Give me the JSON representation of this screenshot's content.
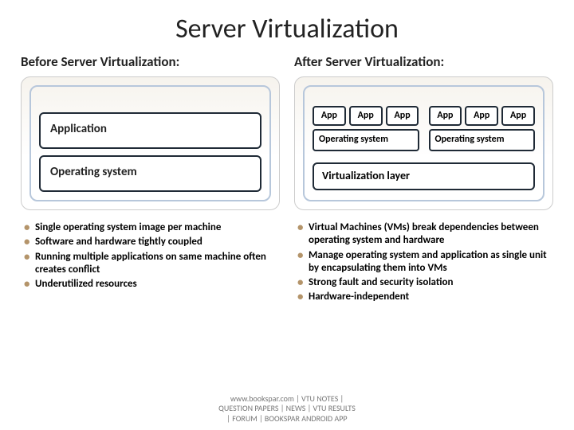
{
  "title": "Server Virtualization",
  "left": {
    "header": "Before Server Virtualization:",
    "application": "Application",
    "os": "Operating system",
    "bullets": [
      "Single operating system image per machine",
      "Software and hardware tightly coupled",
      "Running multiple applications on same machine often creates conflict",
      "Underutilized resources"
    ]
  },
  "right": {
    "header": "After Server Virtualization:",
    "app_label": "App",
    "os_label": "Operating system",
    "virt_label": "Virtualization layer",
    "bullets": [
      "Virtual Machines (VMs) break dependencies between operating system and hardware",
      "Manage operating system and application as single unit by encapsulating them into VMs",
      "Strong fault and security isolation",
      "Hardware-independent"
    ]
  },
  "footer": {
    "line1": "www.bookspar.com | VTU NOTES |",
    "line2": "QUESTION PAPERS | NEWS | VTU RESULTS",
    "line3": "| FORUM | BOOKSPAR ANDROID APP"
  }
}
